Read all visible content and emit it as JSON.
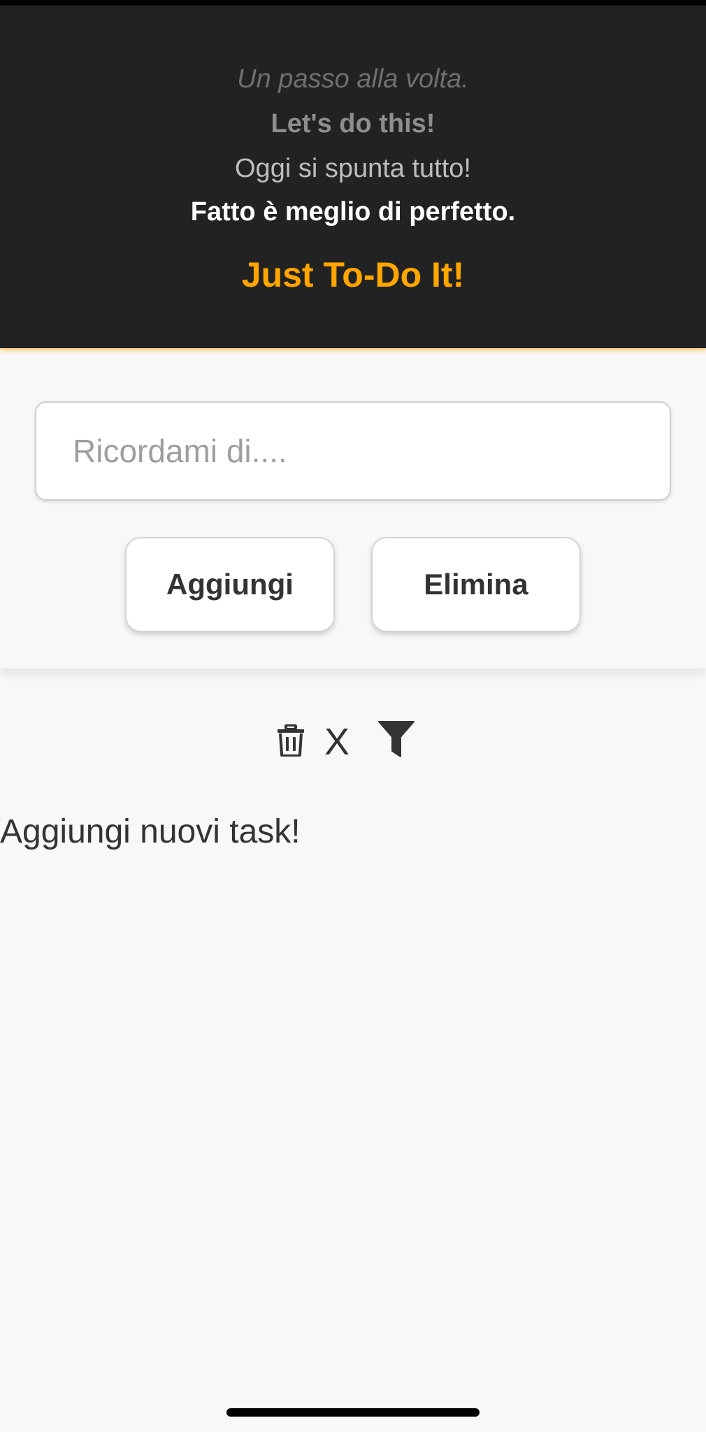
{
  "header": {
    "mottos": [
      "Un passo alla volta.",
      "Let's do this!",
      "Oggi si spunta tutto!",
      "Fatto è meglio di perfetto."
    ],
    "brand": "Just To-Do It!"
  },
  "form": {
    "input_placeholder": "Ricordami di....",
    "input_value": "",
    "add_label": "Aggiungi",
    "delete_label": "Elimina"
  },
  "toolbar": {
    "trash_icon": "trash-icon",
    "clear_label": "X",
    "filter_icon": "filter-icon"
  },
  "list": {
    "empty_message": "Aggiungi nuovi task!"
  },
  "colors": {
    "accent": "#ffa500",
    "header_bg": "#222222",
    "page_bg": "#f8f8f8",
    "text": "#333333"
  }
}
